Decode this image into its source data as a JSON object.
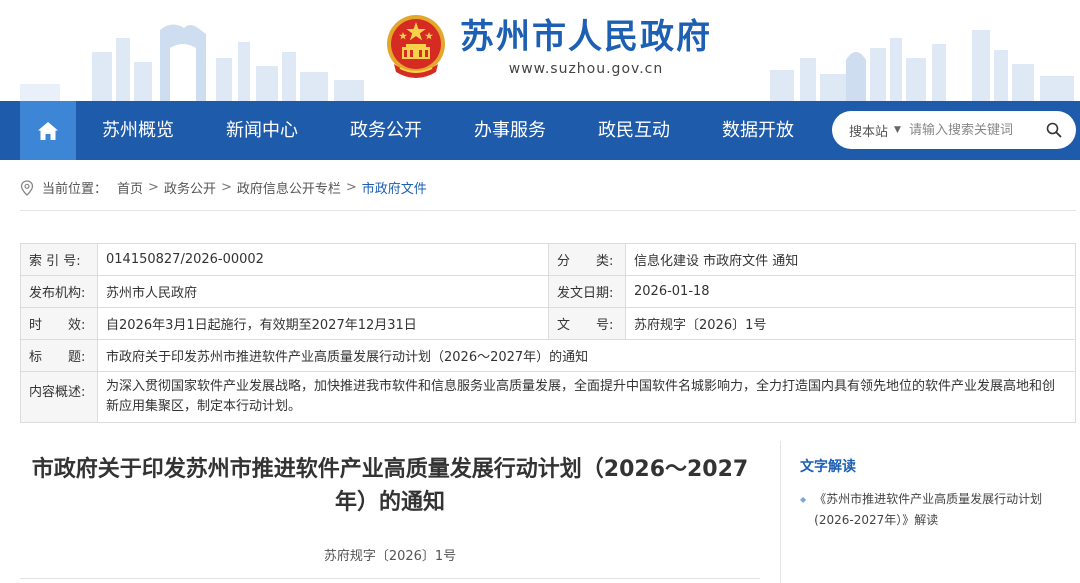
{
  "header": {
    "site_title": "苏州市人民政府",
    "site_url": "www.suzhou.gov.cn",
    "emblem_icon": "national-emblem-icon",
    "brand_color": "#1c5fb3"
  },
  "nav": {
    "home_icon": "home-icon",
    "items": [
      "苏州概览",
      "新闻中心",
      "政务公开",
      "办事服务",
      "政民互动",
      "数据开放"
    ],
    "bar_color": "#1e5bab",
    "home_color": "#3d86d6"
  },
  "search": {
    "site_label": "搜本站",
    "placeholder": "请输入搜索关键词",
    "icon": "search-icon"
  },
  "breadcrumb": {
    "label": "当前位置：",
    "items": [
      "首页",
      "政务公开",
      "政府信息公开专栏",
      "市政府文件"
    ],
    "separator": ">"
  },
  "meta": {
    "index_label": "索 引 号:",
    "index_value": "014150827/2026-00002",
    "category_label": "分　　类:",
    "category_value": "信息化建设 市政府文件 通知",
    "issuer_label": "发布机构:",
    "issuer_value": "苏州市人民政府",
    "date_label": "发文日期:",
    "date_value": "2026-01-18",
    "validity_label": "时　　效:",
    "validity_value": "自2026年3月1日起施行，有效期至2027年12月31日",
    "docno_label": "文　　号:",
    "docno_value": "苏府规字〔2026〕1号",
    "title_label": "标　　题:",
    "title_value": "市政府关于印发苏州市推进软件产业高质量发展行动计划（2026～2027年）的通知",
    "summary_label": "内容概述:",
    "summary_value": "为深入贯彻国家软件产业发展战略，加快推进我市软件和信息服务业高质量发展，全面提升中国软件名城影响力，全力打造国内具有领先地位的软件产业发展高地和创新应用集聚区，制定本行动计划。"
  },
  "article": {
    "title_line1": "市政府关于印发苏州市推进软件产业高质量发展行动计划（2026～2027",
    "title_line2": "年）的通知",
    "doc_no": "苏府规字〔2026〕1号"
  },
  "sidebar": {
    "title": "文字解读",
    "items": [
      {
        "line1": "《苏州市推进软件产业高质量发展行动计划",
        "line2": "(2026-2027年）》解读"
      }
    ]
  }
}
